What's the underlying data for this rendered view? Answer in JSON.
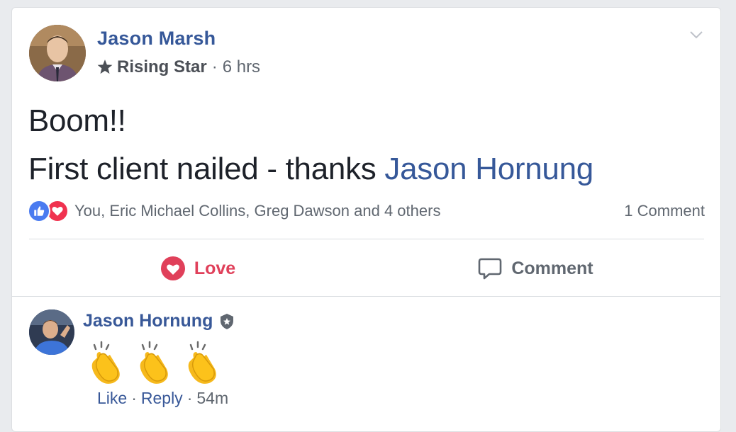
{
  "post": {
    "author": "Jason Marsh",
    "badge": "Rising Star",
    "separator": "·",
    "time": "6 hrs",
    "text_line1": "Boom!!",
    "text_line2_prefix": "First client nailed - thanks ",
    "mention": "Jason Hornung",
    "reactions_summary": "You, Eric Michael Collins, Greg Dawson and 4 others",
    "comment_count": "1 Comment"
  },
  "actions": {
    "love_label": "Love",
    "comment_label": "Comment"
  },
  "comment": {
    "author": "Jason Hornung",
    "content_icons": [
      "clapping-hands-icon",
      "clapping-hands-icon",
      "clapping-hands-icon"
    ],
    "like_label": "Like",
    "separator": "·",
    "reply_label": "Reply",
    "time": "54m"
  },
  "colors": {
    "link_blue": "#365899",
    "love_red": "#e0405a",
    "like_blue": "#4a7bf0",
    "muted_text": "#606770",
    "background": "#e9ebee"
  }
}
